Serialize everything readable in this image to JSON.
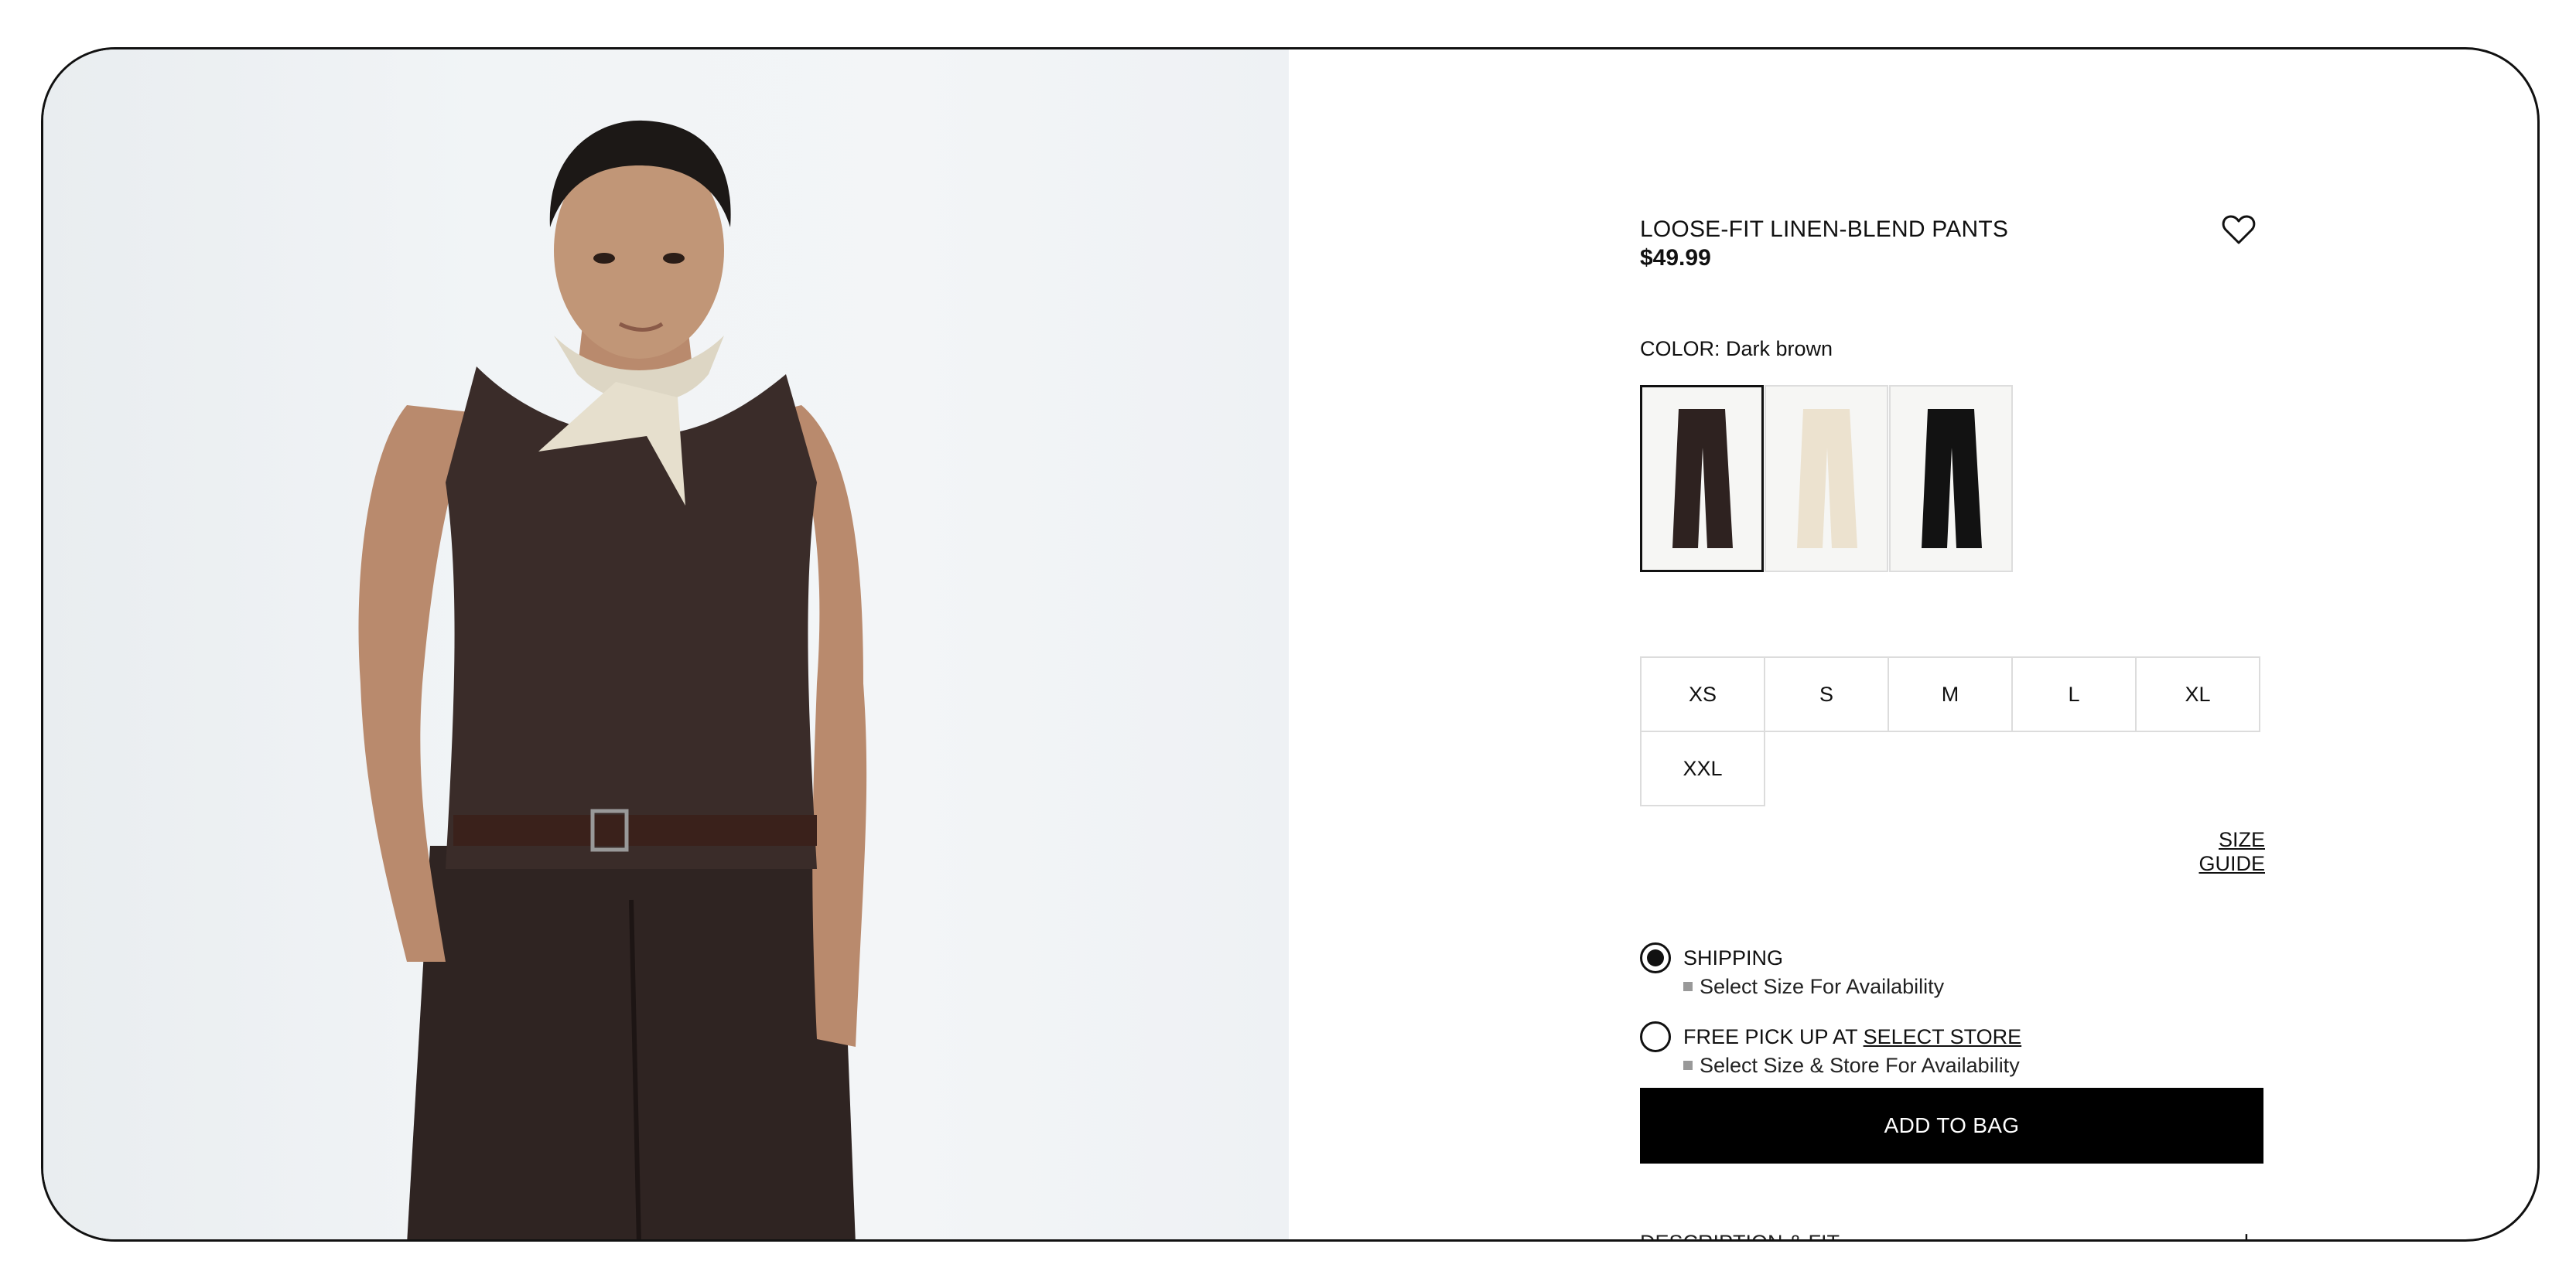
{
  "product": {
    "title": "LOOSE-FIT LINEN-BLEND PANTS",
    "price": "$49.99",
    "color_label": "COLOR: Dark brown",
    "swatches": [
      {
        "name": "Dark brown",
        "fill": "#2e2220"
      },
      {
        "name": "Light beige",
        "fill": "#ece2cf"
      },
      {
        "name": "Black",
        "fill": "#121212"
      }
    ],
    "selected_swatch": "Dark brown"
  },
  "icons": {
    "wishlist": "heart-icon"
  },
  "sizes": [
    "XS",
    "S",
    "M",
    "L",
    "XL",
    "XXL"
  ],
  "size_guide_label": "SIZE GUIDE",
  "delivery": {
    "shipping_label": "SHIPPING",
    "shipping_sub": "Select Size For Availability",
    "pickup_prefix": "FREE PICK UP AT",
    "pickup_link": "SELECT STORE",
    "pickup_sub": "Select Size & Store For Availability",
    "selected": "shipping"
  },
  "add_to_bag_label": "ADD TO BAG",
  "description_label": "DESCRIPTION & FIT",
  "description_toggle": "+",
  "colors": {
    "button_bg": "#000000",
    "accent": "#111111"
  }
}
